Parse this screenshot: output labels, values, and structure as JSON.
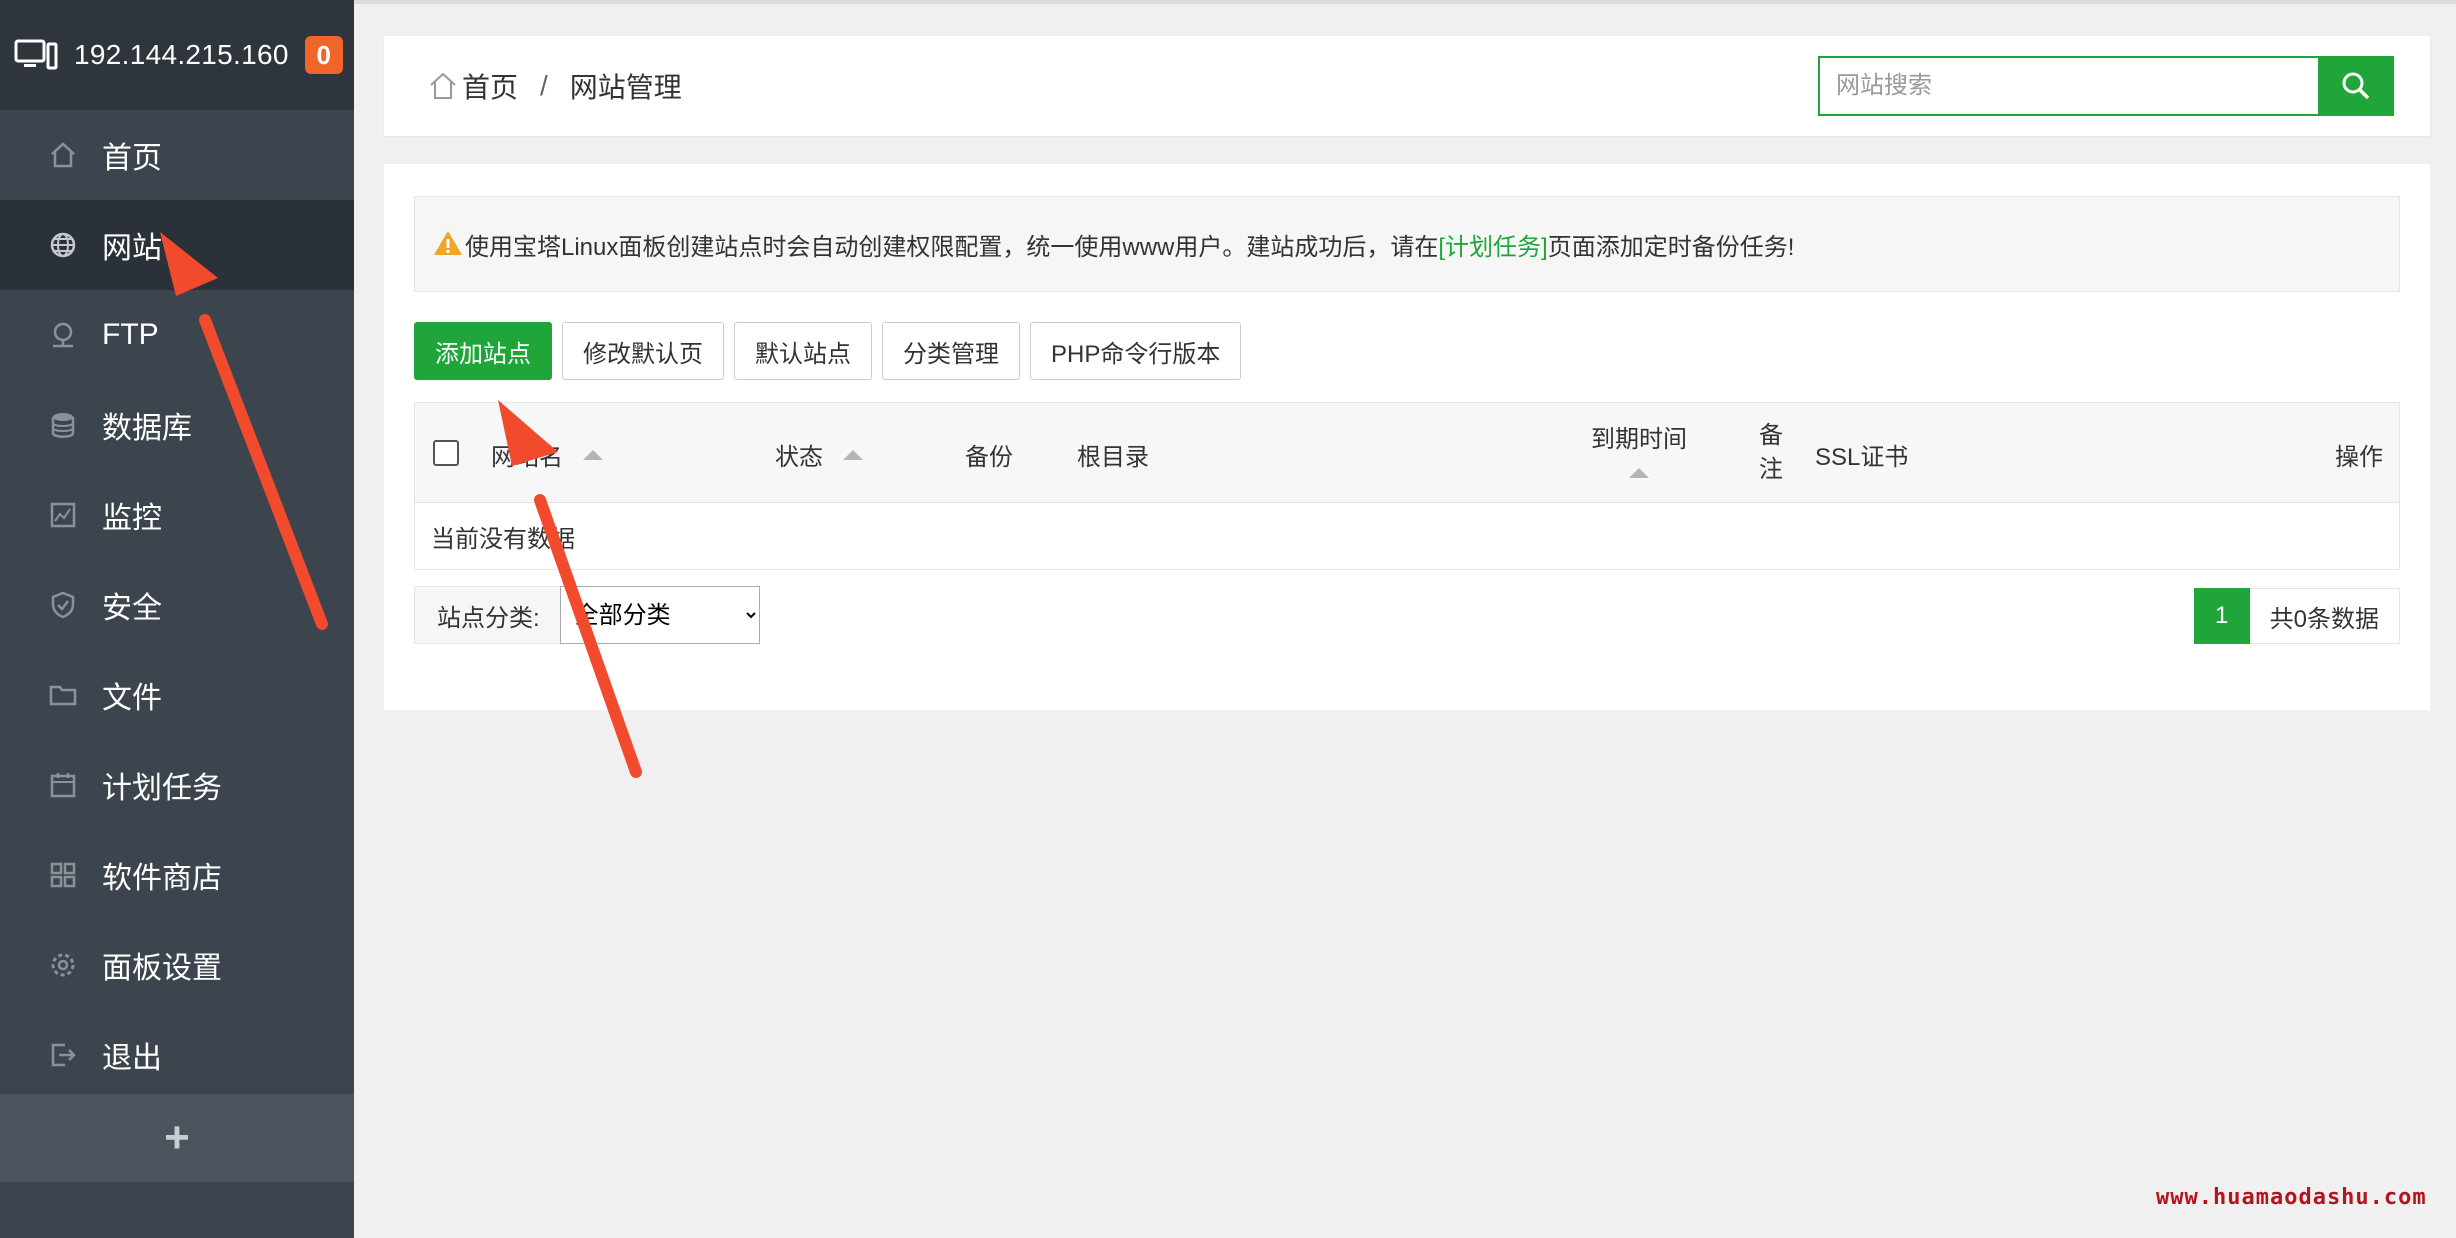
{
  "sidebar": {
    "ip": "192.144.215.160",
    "badge": "0",
    "items": [
      {
        "label": "首页",
        "icon": "home-icon"
      },
      {
        "label": "网站",
        "icon": "globe-icon",
        "active": true
      },
      {
        "label": "FTP",
        "icon": "ftp-icon"
      },
      {
        "label": "数据库",
        "icon": "database-icon"
      },
      {
        "label": "监控",
        "icon": "monitor-chart-icon"
      },
      {
        "label": "安全",
        "icon": "shield-icon"
      },
      {
        "label": "文件",
        "icon": "folder-icon"
      },
      {
        "label": "计划任务",
        "icon": "calendar-icon"
      },
      {
        "label": "软件商店",
        "icon": "apps-grid-icon"
      },
      {
        "label": "面板设置",
        "icon": "gear-icon"
      },
      {
        "label": "退出",
        "icon": "logout-icon"
      }
    ],
    "add_label": "+"
  },
  "breadcrumb": {
    "home": "首页",
    "separator": "/",
    "current": "网站管理"
  },
  "search": {
    "placeholder": "网站搜索",
    "value": ""
  },
  "notice": {
    "text_before": "使用宝塔Linux面板创建站点时会自动创建权限配置，统一使用www用户。建站成功后，请在",
    "link": "[计划任务]",
    "text_after": "页面添加定时备份任务!"
  },
  "toolbar": {
    "add_site": "添加站点",
    "edit_default_page": "修改默认页",
    "default_site": "默认站点",
    "category_manage": "分类管理",
    "php_cli_version": "PHP命令行版本"
  },
  "table": {
    "headers": {
      "domain": "网站名",
      "status": "状态",
      "backup": "备份",
      "root": "根目录",
      "expire": "到期时间",
      "remark_1": "备",
      "remark_2": "注",
      "ssl": "SSL证书",
      "action": "操作"
    },
    "empty_text": "当前没有数据"
  },
  "filter": {
    "label": "站点分类:",
    "selected": "全部分类"
  },
  "pagination": {
    "page": "1",
    "total_text": "共0条数据"
  },
  "watermark": "www.huamaodashu.com",
  "colors": {
    "accent": "#20a53a",
    "sidebar": "#3c444d",
    "badge": "#f0652a",
    "annotation_arrow": "#f24a2c"
  }
}
